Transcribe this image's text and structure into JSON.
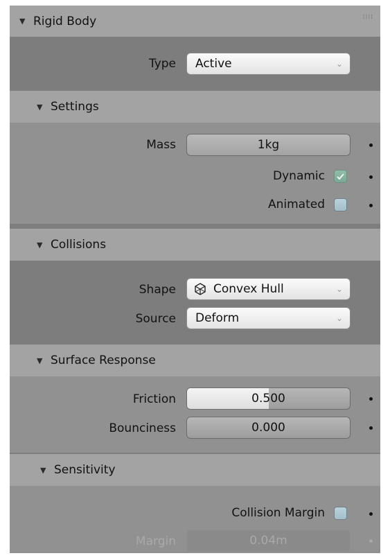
{
  "panel": {
    "title": "Rigid Body",
    "type_label": "Type",
    "type_value": "Active"
  },
  "settings": {
    "title": "Settings",
    "mass_label": "Mass",
    "mass_value": "1kg",
    "dynamic_label": "Dynamic",
    "dynamic_checked": true,
    "animated_label": "Animated",
    "animated_checked": false
  },
  "collisions": {
    "title": "Collisions",
    "shape_label": "Shape",
    "shape_value": "Convex Hull",
    "shape_icon": "convex-hull-icon",
    "source_label": "Source",
    "source_value": "Deform"
  },
  "surface_response": {
    "title": "Surface Response",
    "friction_label": "Friction",
    "friction_value": "0.500",
    "friction_fraction": 0.5,
    "bounciness_label": "Bounciness",
    "bounciness_value": "0.000",
    "bounciness_fraction": 0.0
  },
  "sensitivity": {
    "title": "Sensitivity",
    "collision_margin_label": "Collision Margin",
    "collision_margin_checked": false,
    "margin_label": "Margin",
    "margin_value": "0.04m"
  }
}
